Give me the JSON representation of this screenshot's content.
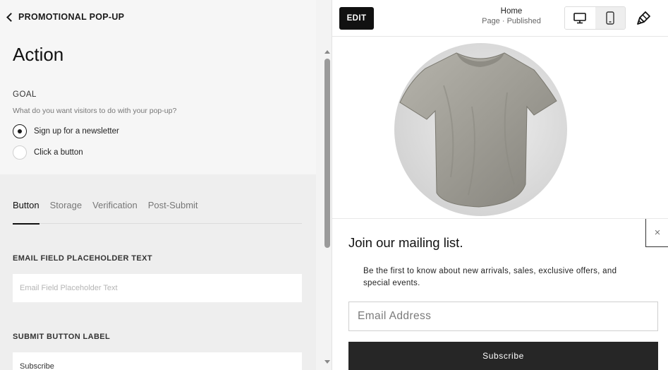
{
  "editor": {
    "back_label": "PROMOTIONAL POP-UP",
    "heading": "Action",
    "goal": {
      "label": "GOAL",
      "question": "What do you want visitors to do with your pop-up?",
      "options": [
        {
          "label": "Sign up for a newsletter",
          "selected": true
        },
        {
          "label": "Click a button",
          "selected": false
        }
      ]
    },
    "tabs": [
      "Button",
      "Storage",
      "Verification",
      "Post-Submit"
    ],
    "active_tab": "Button",
    "email_placeholder_section": {
      "label": "EMAIL FIELD PLACEHOLDER TEXT",
      "placeholder": "Email Field Placeholder Text",
      "value": ""
    },
    "submit_label_section": {
      "label": "SUBMIT BUTTON LABEL",
      "value": "Subscribe"
    }
  },
  "preview": {
    "edit_label": "EDIT",
    "page_name": "Home",
    "page_status": "Page · Published",
    "device_view": "desktop",
    "icons": [
      "desktop-icon",
      "mobile-icon",
      "paintbrush-icon",
      "close-icon",
      "chevron-left-icon"
    ],
    "popup": {
      "title": "Join our mailing list.",
      "description": "Be the first to know about new arrivals, sales, exclusive offers, and special events.",
      "email_placeholder": "Email Address",
      "button_label": "Subscribe",
      "close_symbol": "×"
    }
  },
  "colors": {
    "accent_dark": "#111111",
    "button_dark": "#262626",
    "panel_bg": "#f3f3f3"
  }
}
